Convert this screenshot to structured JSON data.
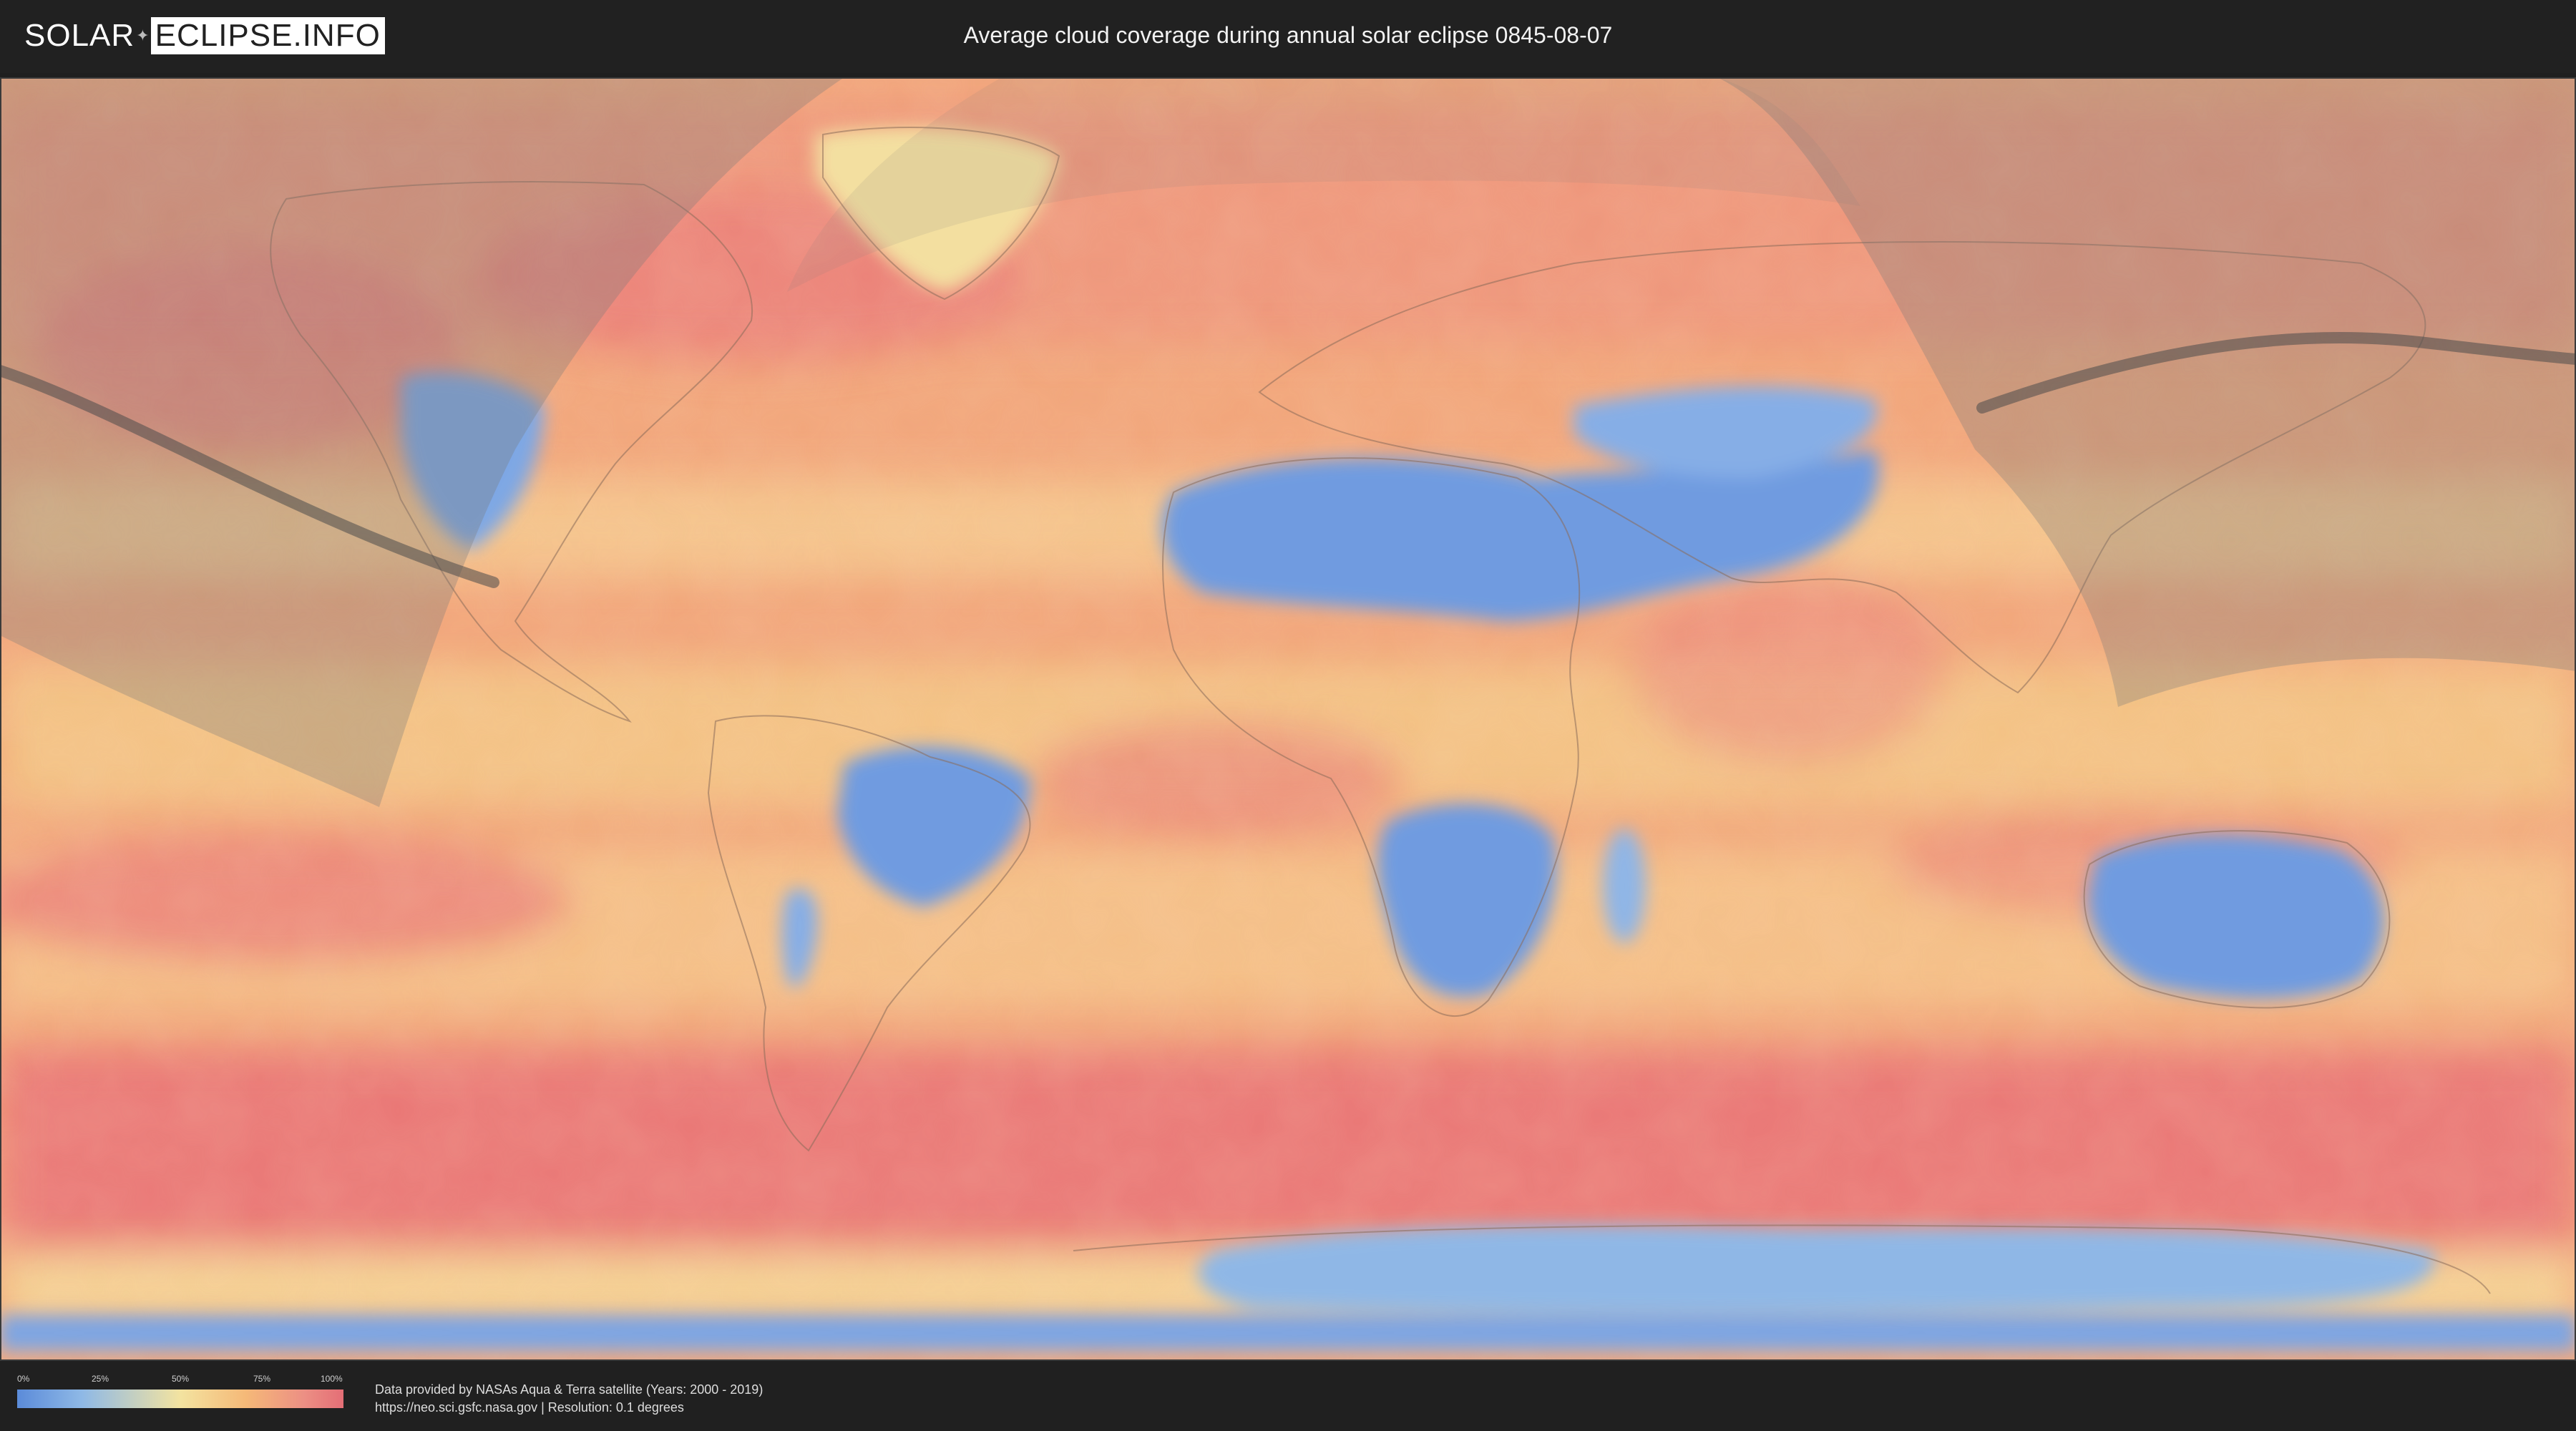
{
  "header": {
    "logo_left": "SOLAR",
    "logo_right": "ECLIPSE.INFO",
    "title": "Average cloud coverage during annual solar eclipse 0845-08-07"
  },
  "map": {
    "description_icon": "world-cloud-map",
    "colors": {
      "clear": "#6f9be0",
      "low": "#9cc4e6",
      "mid": "#f5dd9a",
      "high": "#f4ad7c",
      "overcast": "#e97678",
      "shadow_overlay": "#7a7a7a",
      "central_path": "#4a4a4a"
    }
  },
  "legend": {
    "ticks": [
      "0%",
      "25%",
      "50%",
      "75%",
      "100%"
    ]
  },
  "footer": {
    "credit_line_1": "Data provided by NASAs Aqua & Terra satellite (Years: 2000 - 2019)",
    "credit_line_2": "https://neo.sci.gsfc.nasa.gov | Resolution: 0.1 degrees"
  }
}
